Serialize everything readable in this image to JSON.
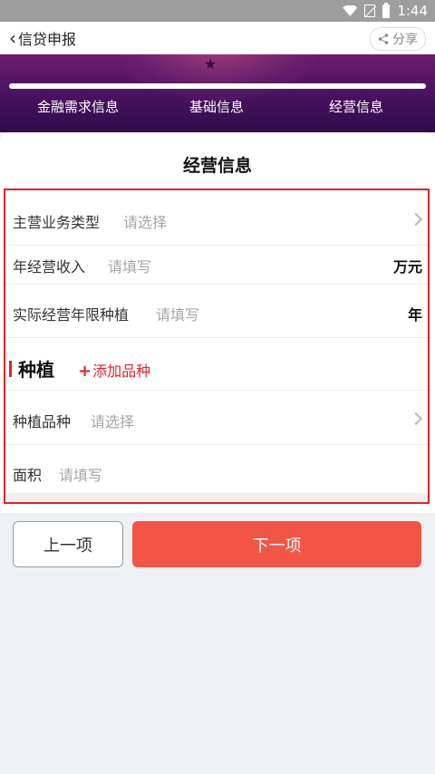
{
  "status_bar": {
    "time": "1:44"
  },
  "header": {
    "title": "信贷申报",
    "share_label": "分享"
  },
  "progress": {
    "value": 1.0
  },
  "steps": [
    "金融需求信息",
    "基础信息",
    "经营信息"
  ],
  "section": {
    "title": "经营信息",
    "rows": [
      {
        "label": "主营业务类型",
        "placeholder": "请选择"
      },
      {
        "label": "年经营收入",
        "placeholder": "请填写",
        "unit": "万元"
      },
      {
        "label": "实际经营年限种植",
        "placeholder": "请填写",
        "unit": "年"
      }
    ],
    "group": {
      "title": "种植",
      "add_label": "添加品种",
      "rows": [
        {
          "label": "种植品种",
          "placeholder": "请选择"
        },
        {
          "label": "面积",
          "placeholder": "请填写"
        }
      ]
    }
  },
  "buttons": {
    "prev": "上一项",
    "next": "下一项"
  },
  "colors": {
    "accent": "#f25546",
    "highlight_border": "#e0232a",
    "banner": "#4d1462"
  }
}
